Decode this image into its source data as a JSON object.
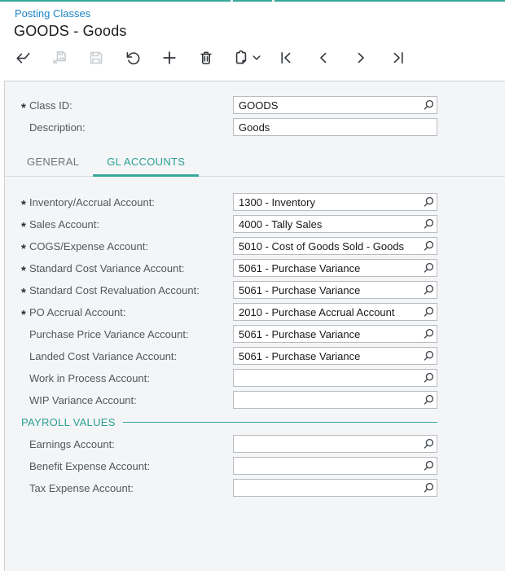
{
  "window": {
    "breadcrumb": "Posting Classes",
    "title": "GOODS - Goods"
  },
  "toolbar": {
    "icons": [
      "arrow-back",
      "save-and-close",
      "save",
      "undo",
      "add-new",
      "delete",
      "clipboard",
      "chevron-down",
      "go-first",
      "go-previous",
      "go-next",
      "go-last"
    ],
    "disabled_icons": [
      "save-and-close",
      "save"
    ]
  },
  "header_fields": [
    {
      "label": "Class ID:",
      "value": "GOODS",
      "required": true,
      "lookup": true
    },
    {
      "label": "Description:",
      "value": "Goods",
      "required": false,
      "lookup": false
    }
  ],
  "tabs": [
    {
      "label": "GENERAL",
      "active": false
    },
    {
      "label": "GL ACCOUNTS",
      "active": true
    }
  ],
  "gl_accounts": {
    "fields": [
      {
        "label": "Inventory/Accrual Account:",
        "value": "1300 - Inventory",
        "required": true,
        "lookup": true
      },
      {
        "label": "Sales Account:",
        "value": "4000 - Tally Sales",
        "required": true,
        "lookup": true
      },
      {
        "label": "COGS/Expense Account:",
        "value": "5010 - Cost of Goods Sold - Goods",
        "required": true,
        "lookup": true
      },
      {
        "label": "Standard Cost Variance Account:",
        "value": "5061 - Purchase Variance",
        "required": true,
        "lookup": true
      },
      {
        "label": "Standard Cost Revaluation Account:",
        "value": "5061 - Purchase Variance",
        "required": true,
        "lookup": true
      },
      {
        "label": "PO Accrual Account:",
        "value": "2010 - Purchase Accrual Account",
        "required": true,
        "lookup": true
      },
      {
        "label": "Purchase Price Variance Account:",
        "value": "5061 - Purchase Variance",
        "required": false,
        "lookup": true
      },
      {
        "label": "Landed Cost Variance Account:",
        "value": "5061 - Purchase Variance",
        "required": false,
        "lookup": true
      },
      {
        "label": "Work in Process Account:",
        "value": "",
        "required": false,
        "lookup": true
      },
      {
        "label": "WIP Variance Account:",
        "value": "",
        "required": false,
        "lookup": true
      }
    ]
  },
  "payroll": {
    "title": "PAYROLL VALUES",
    "fields": [
      {
        "label": "Earnings Account:",
        "value": "",
        "required": false,
        "lookup": true
      },
      {
        "label": "Benefit Expense Account:",
        "value": "",
        "required": false,
        "lookup": true
      },
      {
        "label": "Tax Expense Account:",
        "value": "",
        "required": false,
        "lookup": true
      }
    ]
  },
  "colors": {
    "accent_teal": "#36a79b",
    "link_blue": "#1b83c6"
  }
}
